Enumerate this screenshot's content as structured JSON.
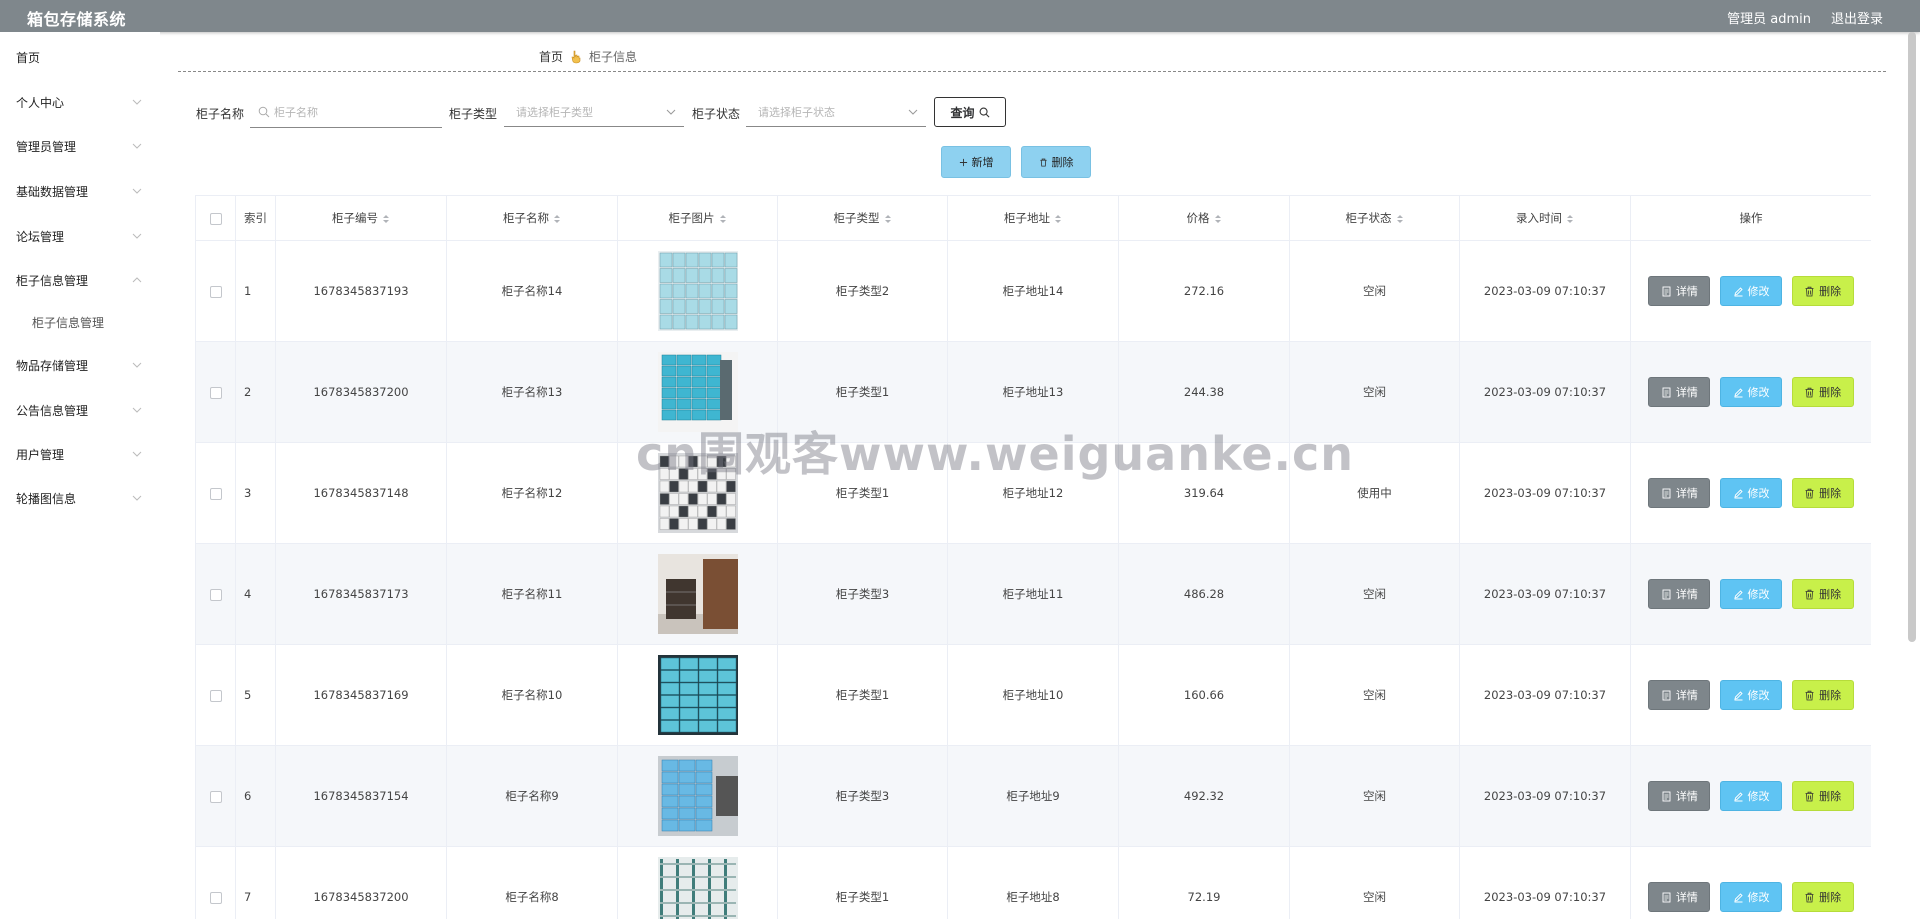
{
  "header": {
    "title": "箱包存储系统",
    "user": "管理员 admin",
    "logout": "退出登录"
  },
  "sidebar": {
    "items": [
      {
        "label": "首页",
        "chevron": false
      },
      {
        "label": "个人中心",
        "chevron": "down"
      },
      {
        "label": "管理员管理",
        "chevron": "down"
      },
      {
        "label": "基础数据管理",
        "chevron": "down"
      },
      {
        "label": "论坛管理",
        "chevron": "down"
      },
      {
        "label": "柜子信息管理",
        "chevron": "up"
      },
      {
        "label": "物品存储管理",
        "chevron": "down"
      },
      {
        "label": "公告信息管理",
        "chevron": "down"
      },
      {
        "label": "用户管理",
        "chevron": "down"
      },
      {
        "label": "轮播图信息",
        "chevron": "down"
      }
    ],
    "sub_item": "柜子信息管理"
  },
  "breadcrumb": {
    "home": "首页",
    "current": "柜子信息"
  },
  "search": {
    "name_label": "柜子名称",
    "name_placeholder": "柜子名称",
    "type_label": "柜子类型",
    "type_placeholder": "请选择柜子类型",
    "status_label": "柜子状态",
    "status_placeholder": "请选择柜子状态",
    "query_button": "查询"
  },
  "actions": {
    "add": "新增",
    "delete": "删除"
  },
  "table": {
    "columns": [
      "索引",
      "柜子编号",
      "柜子名称",
      "柜子图片",
      "柜子类型",
      "柜子地址",
      "价格",
      "柜子状态",
      "录入时间",
      "操作"
    ],
    "rows": [
      {
        "index": "1",
        "code": "1678345837193",
        "name": "柜子名称14",
        "type": "柜子类型2",
        "address": "柜子地址14",
        "price": "272.16",
        "status": "空闲",
        "time": "2023-03-09 07:10:37"
      },
      {
        "index": "2",
        "code": "1678345837200",
        "name": "柜子名称13",
        "type": "柜子类型1",
        "address": "柜子地址13",
        "price": "244.38",
        "status": "空闲",
        "time": "2023-03-09 07:10:37"
      },
      {
        "index": "3",
        "code": "1678345837148",
        "name": "柜子名称12",
        "type": "柜子类型1",
        "address": "柜子地址12",
        "price": "319.64",
        "status": "使用中",
        "time": "2023-03-09 07:10:37"
      },
      {
        "index": "4",
        "code": "1678345837173",
        "name": "柜子名称11",
        "type": "柜子类型3",
        "address": "柜子地址11",
        "price": "486.28",
        "status": "空闲",
        "time": "2023-03-09 07:10:37"
      },
      {
        "index": "5",
        "code": "1678345837169",
        "name": "柜子名称10",
        "type": "柜子类型1",
        "address": "柜子地址10",
        "price": "160.66",
        "status": "空闲",
        "time": "2023-03-09 07:10:37"
      },
      {
        "index": "6",
        "code": "1678345837154",
        "name": "柜子名称9",
        "type": "柜子类型3",
        "address": "柜子地址9",
        "price": "492.32",
        "status": "空闲",
        "time": "2023-03-09 07:10:37"
      },
      {
        "index": "7",
        "code": "1678345837200",
        "name": "柜子名称8",
        "type": "柜子类型1",
        "address": "柜子地址8",
        "price": "72.19",
        "status": "空闲",
        "time": "2023-03-09 07:10:37"
      }
    ],
    "op_detail": "详情",
    "op_edit": "修改",
    "op_delete": "删除"
  },
  "watermark": "cn围观客www.weiguanke.cn",
  "colors": {
    "header_bg": "#7f878c",
    "btn_light": "#8ed1f0",
    "op_detail": "#7e868b",
    "op_edit": "#5fc4f3",
    "op_delete": "#c8f04a"
  }
}
